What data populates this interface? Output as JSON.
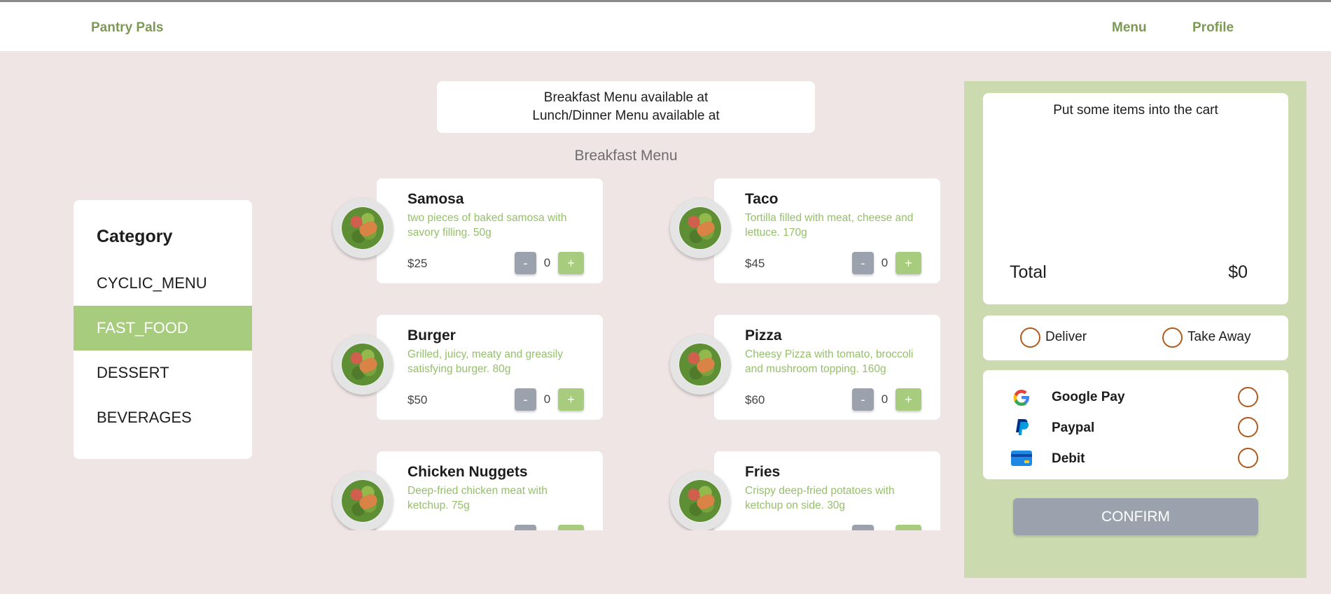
{
  "header": {
    "brand": "Pantry Pals",
    "nav": [
      "Menu",
      "Profile"
    ]
  },
  "category": {
    "title": "Category",
    "items": [
      "CYCLIC_MENU",
      "FAST_FOOD",
      "DESSERT",
      "BEVERAGES"
    ],
    "active": "FAST_FOOD"
  },
  "notice": {
    "line1": "Breakfast Menu available at",
    "line2": "Lunch/Dinner Menu available at"
  },
  "menu_title": "Breakfast Menu",
  "items": [
    {
      "name": "Samosa",
      "desc": "two pieces of baked samosa with savory filling. 50g",
      "price": "$25",
      "qty": "0"
    },
    {
      "name": "Taco",
      "desc": "Tortilla filled with meat, cheese and lettuce. 170g",
      "price": "$45",
      "qty": "0"
    },
    {
      "name": "Burger",
      "desc": "Grilled, juicy, meaty and greasily satisfying burger. 80g",
      "price": "$50",
      "qty": "0"
    },
    {
      "name": "Pizza",
      "desc": "Cheesy Pizza with tomato, broccoli and mushroom topping. 160g",
      "price": "$60",
      "qty": "0"
    },
    {
      "name": "Chicken Nuggets",
      "desc": "Deep-fried chicken meat with ketchup. 75g",
      "price": "",
      "qty": ""
    },
    {
      "name": "Fries",
      "desc": "Crispy deep-fried potatoes with ketchup on side. 30g",
      "price": "",
      "qty": ""
    }
  ],
  "qty_controls": {
    "minus": "-",
    "plus": "+"
  },
  "cart": {
    "empty_text": "Put some items into the cart",
    "total_label": "Total",
    "total_value": "$0"
  },
  "delivery": {
    "options": [
      "Deliver",
      "Take Away"
    ]
  },
  "payment": {
    "options": [
      {
        "label": "Google Pay",
        "icon": "google-icon"
      },
      {
        "label": "Paypal",
        "icon": "paypal-icon"
      },
      {
        "label": "Debit",
        "icon": "credit-card-icon"
      }
    ]
  },
  "confirm_label": "CONFIRM",
  "colors": {
    "accent": "#a8cc7e",
    "brand": "#7c9a55",
    "panel": "#ccdab0",
    "background": "#efe5e5",
    "disabled": "#9ba2ad",
    "radio": "#b05a1c"
  }
}
